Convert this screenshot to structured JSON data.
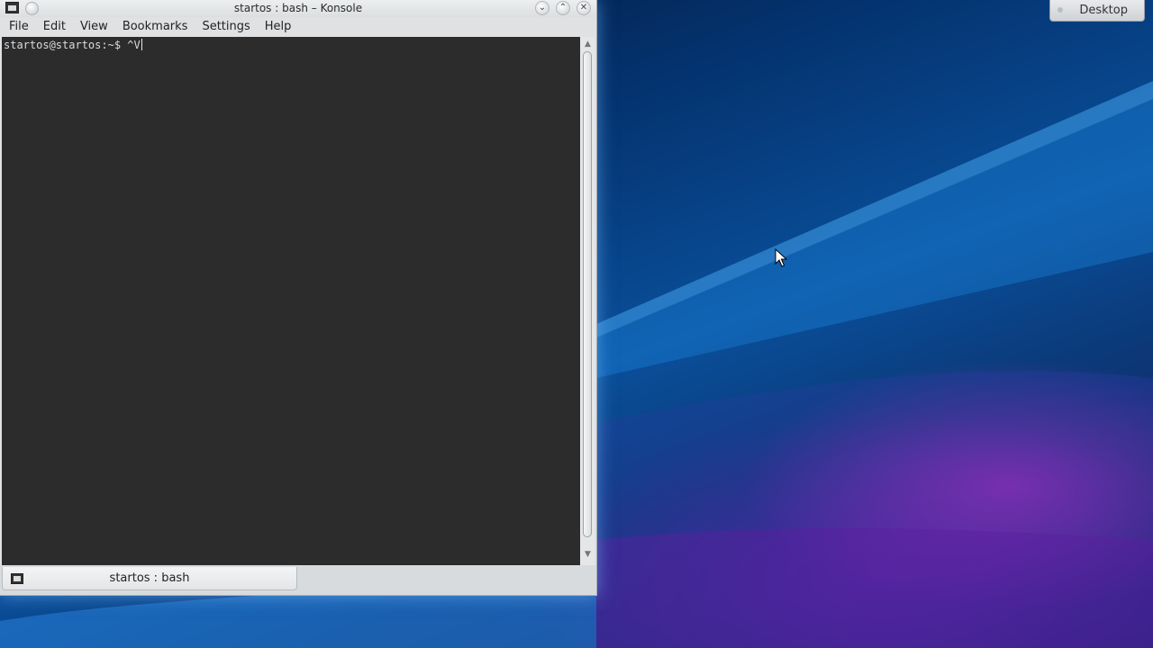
{
  "window": {
    "title": "startos : bash – Konsole",
    "controls": {
      "minimize": "⌄",
      "maximize": "⌃",
      "close": "✕"
    }
  },
  "menubar": {
    "items": [
      {
        "label": "File"
      },
      {
        "label": "Edit"
      },
      {
        "label": "View"
      },
      {
        "label": "Bookmarks"
      },
      {
        "label": "Settings"
      },
      {
        "label": "Help"
      }
    ]
  },
  "terminal": {
    "prompt": "startos@startos:~$ ",
    "input": "^V"
  },
  "tabs": [
    {
      "label": "startos : bash"
    }
  ],
  "desktop": {
    "button_label": "Desktop"
  },
  "icons": {
    "window_app_icon": "terminal-icon",
    "tab_icon": "terminal-icon",
    "pointer": "mouse-pointer-icon"
  },
  "colors": {
    "terminal_bg": "#2c2c2c",
    "terminal_fg": "#dcdcdc",
    "chrome": "#dfe1e3"
  }
}
